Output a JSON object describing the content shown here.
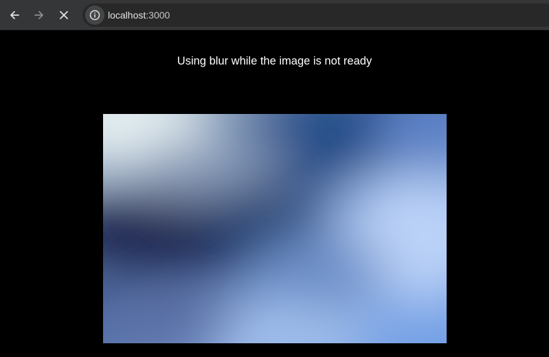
{
  "browser": {
    "url_host": "localhost",
    "url_port": ":3000",
    "icons": {
      "back": "arrow-left-icon",
      "forward": "arrow-right-icon",
      "stop": "close-icon",
      "site_info": "info-icon"
    }
  },
  "page": {
    "heading": "Using blur while the image is not ready",
    "image": {
      "state": "blurred placeholder",
      "colors": [
        "#e6f0f2",
        "#1a2a55",
        "#1f4a86",
        "#b9d2f7",
        "#6f9ae0"
      ]
    }
  }
}
